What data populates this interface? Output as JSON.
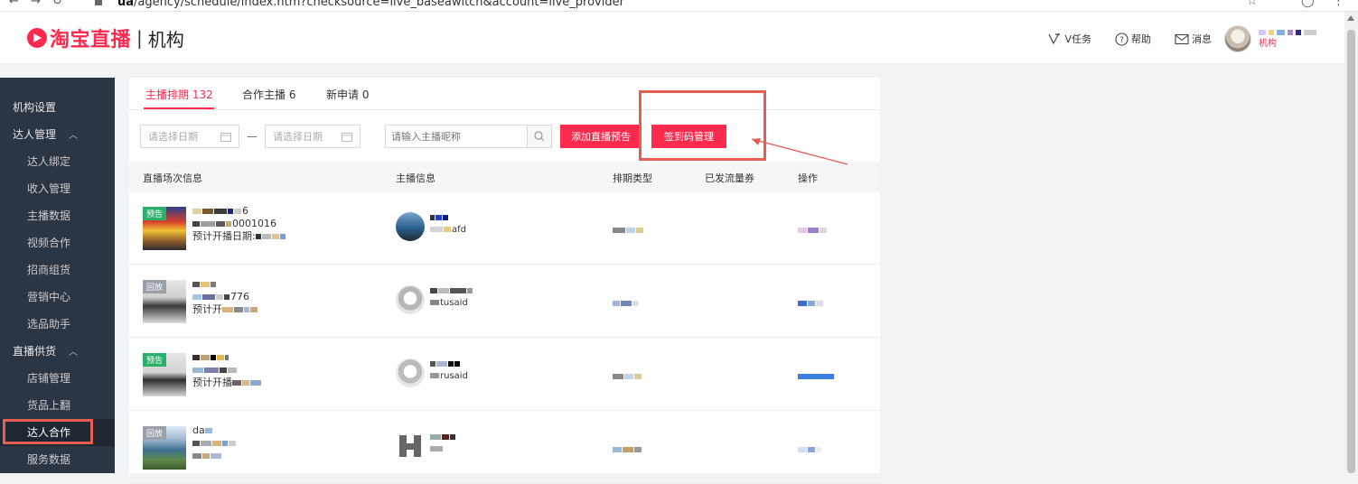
{
  "browser": {
    "back": "←",
    "forward": "→",
    "reload": "↻",
    "lock": "🔒",
    "url_prefix": "ua",
    "url_bold": "",
    "url_rest": "/agency/schedule/index.htm?checksource=live_baseawitch&account=live_provider"
  },
  "header": {
    "brand": "淘宝直播",
    "separator": "|",
    "section": "机构",
    "links": [
      {
        "icon": "v-task-icon",
        "label": "V任务"
      },
      {
        "icon": "help-icon",
        "label": "帮助"
      },
      {
        "icon": "message-icon",
        "label": "消息"
      }
    ],
    "user_role": "机构"
  },
  "sidebar": {
    "items": [
      {
        "label": "机构设置",
        "level": "top"
      },
      {
        "label": "达人管理",
        "level": "top",
        "caret": "︿"
      },
      {
        "label": "达人绑定",
        "level": "sub"
      },
      {
        "label": "收入管理",
        "level": "sub"
      },
      {
        "label": "主播数据",
        "level": "sub"
      },
      {
        "label": "视频合作",
        "level": "sub"
      },
      {
        "label": "招商组货",
        "level": "sub"
      },
      {
        "label": "营销中心",
        "level": "sub"
      },
      {
        "label": "选品助手",
        "level": "sub"
      },
      {
        "label": "直播供货",
        "level": "top",
        "caret": "︿"
      },
      {
        "label": "店铺管理",
        "level": "sub"
      },
      {
        "label": "货品上翻",
        "level": "sub"
      },
      {
        "label": "达人合作",
        "level": "sub",
        "active": true
      },
      {
        "label": "服务数据",
        "level": "sub"
      }
    ]
  },
  "tabs": [
    {
      "label": "主播排期 132",
      "active": true
    },
    {
      "label": "合作主播 6"
    },
    {
      "label": "新申请 0"
    }
  ],
  "filters": {
    "start_date_placeholder": "请选择日期",
    "end_date_placeholder": "请选择日期",
    "dash": "—",
    "search_placeholder": "请输入主播昵称",
    "add_preview_button": "添加直播预告",
    "checkin_code_button": "签到码管理"
  },
  "table": {
    "headers": [
      "直播场次信息",
      "主播信息",
      "排期类型",
      "已发流量券",
      "操作"
    ],
    "rows": [
      {
        "badge": "预告",
        "badge_type": "pre",
        "line1": "6",
        "line2": "0001016",
        "line3": "预计开播日期:",
        "anchor_line2": "afd"
      },
      {
        "badge": "回放",
        "badge_type": "rep",
        "line1": "",
        "line2": "776",
        "line3": "预计开",
        "anchor_line2": "tusaid"
      },
      {
        "badge": "预告",
        "badge_type": "pre",
        "line1": "",
        "line2": "",
        "line3": "预计开播",
        "anchor_line2": "rusaid"
      },
      {
        "badge": "回放",
        "badge_type": "rep",
        "line1": "da",
        "line2": "",
        "line3": "",
        "anchor_line2": ""
      }
    ]
  },
  "colors": {
    "brand_red": "#ff2a4d",
    "sidebar_bg": "#2c3542",
    "annotation_red": "#e85d52",
    "preview_green": "#2ab06b"
  }
}
